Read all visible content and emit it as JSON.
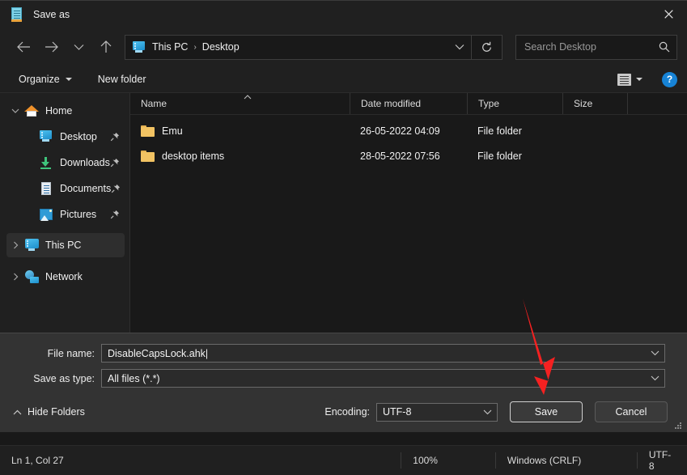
{
  "dialog": {
    "title": "Save as",
    "title_icon": "notepad-icon",
    "close_icon": "close-icon"
  },
  "nav": {
    "back_icon": "arrow-left-icon",
    "forward_icon": "arrow-right-icon",
    "recent_icon": "chevron-down-icon",
    "up_icon": "arrow-up-icon",
    "refresh_icon": "refresh-icon",
    "address_chevron_icon": "chevron-down-icon",
    "breadcrumbs": [
      {
        "label": "This PC",
        "icon": "this-pc-icon"
      },
      {
        "label": "Desktop",
        "icon": ""
      }
    ],
    "separator": "›"
  },
  "search": {
    "placeholder": "Search Desktop",
    "icon": "search-icon"
  },
  "commandbar": {
    "organize": "Organize",
    "new_folder": "New folder",
    "view_icon": "view-layout-icon",
    "view_caret_icon": "caret-down-icon",
    "help_icon": "help-icon",
    "help_label": "?"
  },
  "sidebar": {
    "items": [
      {
        "label": "Home",
        "icon": "home-icon",
        "twisty": "chevron-down",
        "pinned": false,
        "selected": false,
        "indent": 0
      },
      {
        "label": "Desktop",
        "icon": "desktop-icon",
        "twisty": "",
        "pinned": true,
        "selected": false,
        "indent": 1
      },
      {
        "label": "Downloads",
        "icon": "downloads-icon",
        "twisty": "",
        "pinned": true,
        "selected": false,
        "indent": 1
      },
      {
        "label": "Documents",
        "icon": "documents-icon",
        "twisty": "",
        "pinned": true,
        "selected": false,
        "indent": 1
      },
      {
        "label": "Pictures",
        "icon": "pictures-icon",
        "twisty": "",
        "pinned": true,
        "selected": false,
        "indent": 1
      },
      {
        "label": "This PC",
        "icon": "this-pc-icon",
        "twisty": "chevron-right",
        "pinned": false,
        "selected": true,
        "indent": 0
      },
      {
        "label": "Network",
        "icon": "network-icon",
        "twisty": "chevron-right",
        "pinned": false,
        "selected": false,
        "indent": 0
      }
    ],
    "pin_icon": "pin-icon"
  },
  "filelist": {
    "columns": [
      "Name",
      "Date modified",
      "Type",
      "Size"
    ],
    "sort_column": "Name",
    "sort_direction_icon": "sort-ascending-icon",
    "rows": [
      {
        "name": "Emu",
        "date_modified": "26-05-2022 04:09",
        "type": "File folder",
        "size": "",
        "icon": "folder-icon"
      },
      {
        "name": "desktop items",
        "date_modified": "28-05-2022 07:56",
        "type": "File folder",
        "size": "",
        "icon": "folder-icon"
      }
    ]
  },
  "form": {
    "file_name_label": "File name:",
    "file_name_value": "DisableCapsLock.ahk",
    "save_as_type_label": "Save as type:",
    "save_as_type_value": "All files  (*.*)",
    "encoding_label": "Encoding:",
    "encoding_value": "UTF-8",
    "hide_folders_label": "Hide Folders",
    "hide_folders_icon": "chevron-up-icon",
    "save_button": "Save",
    "cancel_button": "Cancel",
    "resize_grip_icon": "resize-grip-icon",
    "combo_caret_icon": "chevron-down-icon"
  },
  "statusbar": {
    "line_col": "Ln 1, Col 27",
    "zoom": "100%",
    "line_ending": "Windows (CRLF)",
    "encoding": "UTF-8"
  },
  "annotation": {
    "arrow_color": "#f52121",
    "points_to": "Save"
  },
  "colors": {
    "dialog_bg": "#202020",
    "list_bg": "#191919",
    "form_bg": "#333333",
    "accent_blue": "#1783d6",
    "folder_yellow": "#f2c363",
    "arrow_red": "#f52121"
  }
}
